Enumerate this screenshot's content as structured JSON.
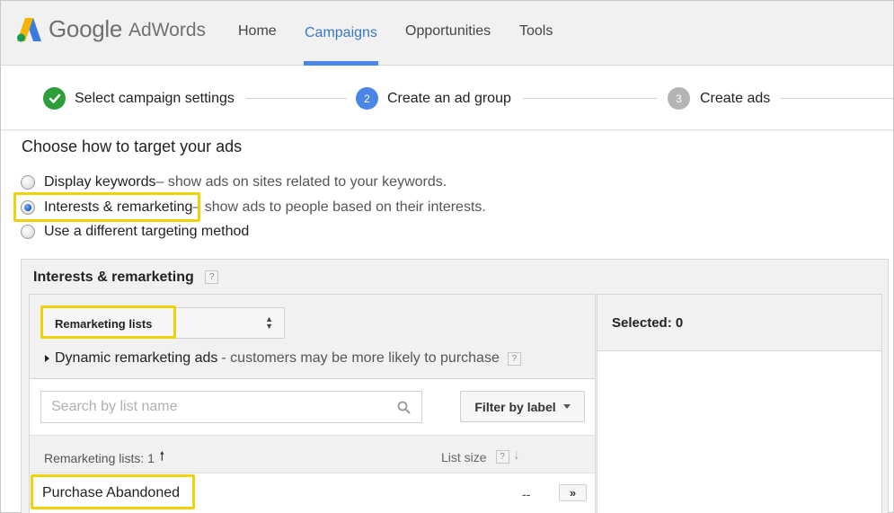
{
  "header": {
    "logo_google": "Google",
    "logo_adwords": "AdWords",
    "nav": [
      {
        "label": "Home",
        "active": false
      },
      {
        "label": "Campaigns",
        "active": true
      },
      {
        "label": "Opportunities",
        "active": false
      },
      {
        "label": "Tools",
        "active": false
      }
    ]
  },
  "stepper": {
    "steps": [
      {
        "label": "Select campaign settings",
        "state": "complete",
        "badge": ""
      },
      {
        "label": "Create an ad group",
        "state": "current",
        "badge": "2"
      },
      {
        "label": "Create ads",
        "state": "upcoming",
        "badge": "3"
      }
    ]
  },
  "targeting": {
    "title": "Choose how to target your ads",
    "options": [
      {
        "label": "Display keywords",
        "desc": " – show ads on sites related to your keywords.",
        "checked": false
      },
      {
        "label": "Interests & remarketing",
        "desc": " – show ads to people based on their interests.",
        "checked": true
      },
      {
        "label": "Use a different targeting method",
        "desc": "",
        "checked": false
      }
    ]
  },
  "panel": {
    "title": "Interests & remarketing",
    "help": "?",
    "dropdown_value": "Remarketing lists",
    "dynamic_label": "Dynamic remarketing ads",
    "dynamic_desc": "- customers may be more likely to purchase",
    "search_placeholder": "Search by list name",
    "filter_label": "Filter by label",
    "table": {
      "col_name": "Remarketing lists: 1",
      "col_size": "List size",
      "rows": [
        {
          "name": "Purchase Abandoned",
          "size": "--",
          "action": "»"
        }
      ]
    },
    "selected_label": "Selected: 0"
  },
  "colors": {
    "accent": "#4a86e8",
    "success": "#2e9e3a",
    "highlight": "#f0d20a",
    "inactive_step": "#b4b4b4"
  }
}
